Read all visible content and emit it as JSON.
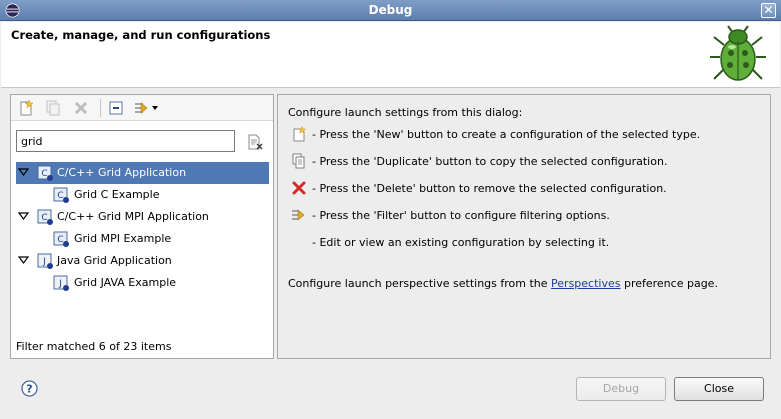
{
  "window": {
    "title": "Debug",
    "close_glyph": "✕"
  },
  "header": {
    "title": "Create, manage, and run configurations",
    "icon": "bug-icon"
  },
  "toolbar": {
    "buttons": [
      "new-configuration-icon",
      "duplicate-icon",
      "delete-icon",
      "collapse-all-icon",
      "filter-icon"
    ]
  },
  "filter": {
    "value": "grid"
  },
  "tree": {
    "items": [
      {
        "label": "C/C++ Grid Application",
        "level": 0,
        "expanded": true,
        "selected": true,
        "icon": "cpp-config-type-icon"
      },
      {
        "label": "Grid C Example",
        "level": 1,
        "icon": "cpp-launch-icon"
      },
      {
        "label": "C/C++ Grid MPI Application",
        "level": 0,
        "expanded": true,
        "selected": false,
        "icon": "cpp-config-type-icon"
      },
      {
        "label": "Grid MPI Example",
        "level": 1,
        "icon": "cpp-launch-icon"
      },
      {
        "label": "Java Grid Application",
        "level": 0,
        "expanded": true,
        "selected": false,
        "icon": "java-config-type-icon"
      },
      {
        "label": "Grid JAVA Example",
        "level": 1,
        "icon": "java-launch-icon"
      }
    ]
  },
  "status": {
    "text": "Filter matched 6 of 23 items"
  },
  "info": {
    "intro": "Configure launch settings from this dialog:",
    "lines": [
      {
        "icon": "new-configuration-icon",
        "text": "- Press the 'New' button to create a configuration of the selected type."
      },
      {
        "icon": "duplicate-icon",
        "text": "- Press the 'Duplicate' button to copy the selected configuration."
      },
      {
        "icon": "delete-icon",
        "text": "- Press the 'Delete' button to remove the selected configuration."
      },
      {
        "icon": "filter-icon",
        "text": "- Press the 'Filter' button to configure filtering options."
      },
      {
        "icon": "",
        "text": "- Edit or view an existing configuration by selecting it."
      }
    ],
    "perspective_prefix": "Configure launch perspective settings from the ",
    "perspective_link": "Perspectives",
    "perspective_suffix": " preference page."
  },
  "buttons": {
    "debug": "Debug",
    "close": "Close",
    "help": "?"
  },
  "colors": {
    "selection": "#4f79b4",
    "title_bar": "#6b8bb8",
    "link": "#1a3f9a",
    "delete_red": "#d22b2b"
  }
}
